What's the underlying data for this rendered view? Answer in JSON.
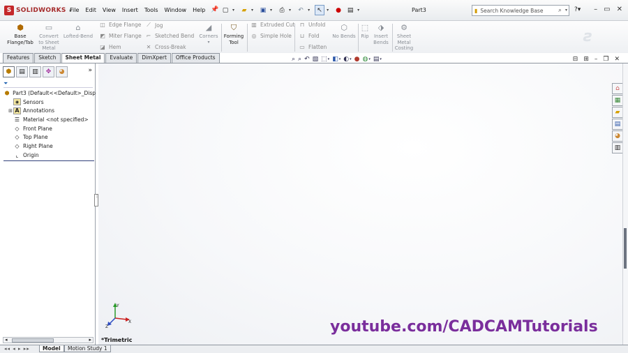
{
  "app": {
    "logo_text": "SOLIDWORKS",
    "document_title": "Part3"
  },
  "menu": [
    "File",
    "Edit",
    "View",
    "Insert",
    "Tools",
    "Window",
    "Help"
  ],
  "search": {
    "placeholder": "Search Knowledge Base"
  },
  "ribbon": {
    "base_flange": "Base Flange/Tab",
    "convert": "Convert to Sheet Metal",
    "lofted_bend": "Lofted-Bend",
    "edge_flange": "Edge Flange",
    "miter_flange": "Miter Flange",
    "hem": "Hem",
    "jog": "Jog",
    "sketched_bend": "Sketched Bend",
    "cross_break": "Cross-Break",
    "corners": "Corners",
    "forming_tool": "Forming Tool",
    "extruded_cut": "Extruded Cut",
    "simple_hole": "Simple Hole",
    "unfold": "Unfold",
    "fold": "Fold",
    "flatten": "Flatten",
    "no_bends": "No Bends",
    "rip": "Rip",
    "insert_bends": "Insert Bends",
    "sheet_metal_costing": "Sheet Metal Costing"
  },
  "tabs": [
    "Features",
    "Sketch",
    "Sheet Metal",
    "Evaluate",
    "DimXpert",
    "Office Products"
  ],
  "active_tab": "Sheet Metal",
  "tree": {
    "root": "Part3  (Default<<Default>_Disp",
    "items": [
      "Sensors",
      "Annotations",
      "Material <not specified>",
      "Front Plane",
      "Top Plane",
      "Right Plane",
      "Origin"
    ]
  },
  "bottom_tabs": [
    "Model",
    "Motion Study 1"
  ],
  "view_name": "*Trimetric",
  "brand": "youtube.com/CADCAMTutorials",
  "triad": {
    "x": "X",
    "y": "Y",
    "z": "Z"
  },
  "colors": {
    "brand": "#7a2e9c",
    "logo": "#c4282a"
  }
}
